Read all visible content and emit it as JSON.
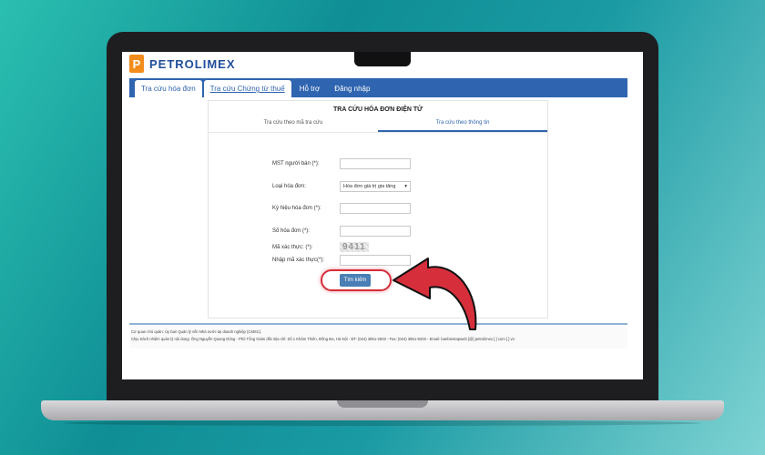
{
  "logo": {
    "text": "PETROLIMEX",
    "mark": "P"
  },
  "nav": {
    "tabs": [
      {
        "label": "Tra cứu hóa đơn"
      },
      {
        "label": "Tra cứu Chứng từ thuế"
      },
      {
        "label": "Hỗ trợ"
      },
      {
        "label": "Đăng nhập"
      }
    ]
  },
  "panel": {
    "title": "TRA CỨU HÓA ĐƠN ĐIỆN TỬ",
    "subtabs": [
      {
        "label": "Tra cứu theo mã tra cứu"
      },
      {
        "label": "Tra cứu theo thông tin"
      }
    ]
  },
  "form": {
    "mst_label": "MST người bán (*):",
    "type_label": "Loại hóa đơn:",
    "type_value": "Hóa đơn giá trị gia tăng",
    "symbol_label": "Ký hiệu hóa đơn (*):",
    "number_label": "Số hóa đơn (*):",
    "captcha_label": "Mã xác thực: (*):",
    "captcha_value": "9411",
    "captcha_input_label": "Nhập mã xác thực(*):",
    "search_button": "Tìm kiếm"
  },
  "footer": {
    "line1": "Cơ quan chủ quản: Ủy ban Quản lý vốn Nhà nước tại doanh nghiệp (CMSC).",
    "line2": "Chịu trách nhiệm quản lý nội dung: Ông Nguyễn Quang Dũng - Phó Tổng Giám đốc Địa chỉ: Số 1 Khâm Thiên, Đống Đa, Hà Nội - ĐT: (024) 3851-2603 - Fax: (024) 3851-9203 - Email: banbientapweb [@] petrolimex [.] com [.] vn"
  },
  "colors": {
    "nav": "#2f64b0",
    "highlight": "#d62e3b",
    "logo_orange": "#f28c1c"
  }
}
